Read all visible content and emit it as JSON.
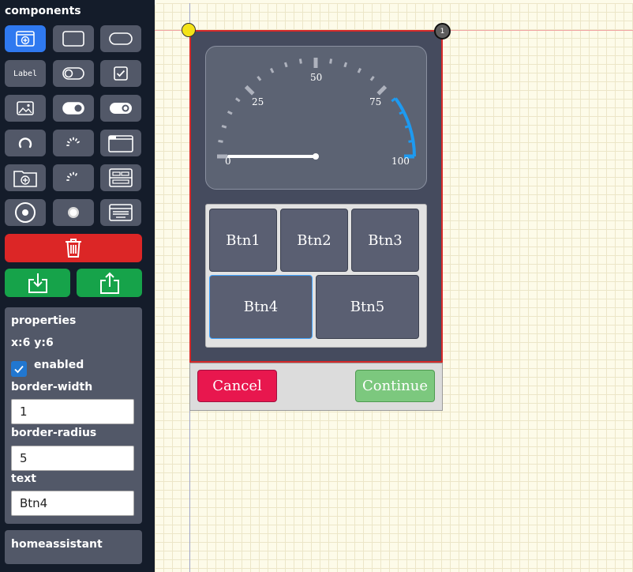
{
  "sidebar": {
    "title": "components",
    "label_widget_text": "Label",
    "icons": [
      "screen-add-icon",
      "rectangle-icon",
      "pill-icon",
      "label-icon",
      "toggle-off-icon",
      "checkbox-icon",
      "image-icon",
      "switch-on-icon",
      "switch-on-alt-icon",
      "arc-icon",
      "spinner-icon",
      "window-icon",
      "folder-add-icon",
      "spinner-alt-icon",
      "tabview-icon",
      "roller-icon",
      "radio-icon",
      "keyboard-icon"
    ],
    "colors": {
      "active": "#2f79f0",
      "delete": "#dc2626",
      "io": "#16a34a"
    }
  },
  "properties": {
    "title": "properties",
    "coords": "x:6  y:6",
    "enabled_label": "enabled",
    "enabled": true,
    "border_width_label": "border-width",
    "border_width": "1",
    "border_radius_label": "border-radius",
    "border_radius": "5",
    "text_label": "text",
    "text": "Btn4"
  },
  "homeassistant": {
    "title": "homeassistant"
  },
  "design": {
    "handle_label": "1",
    "gauge": {
      "ticks": [
        "0",
        "25",
        "50",
        "75",
        "100"
      ],
      "value": 0,
      "range": [
        0,
        100
      ],
      "accent_color": "#1e9af0"
    },
    "buttons": [
      "Btn1",
      "Btn2",
      "Btn3",
      "Btn4",
      "Btn5"
    ],
    "selected_button": "Btn4",
    "cancel": "Cancel",
    "continue": "Continue"
  }
}
